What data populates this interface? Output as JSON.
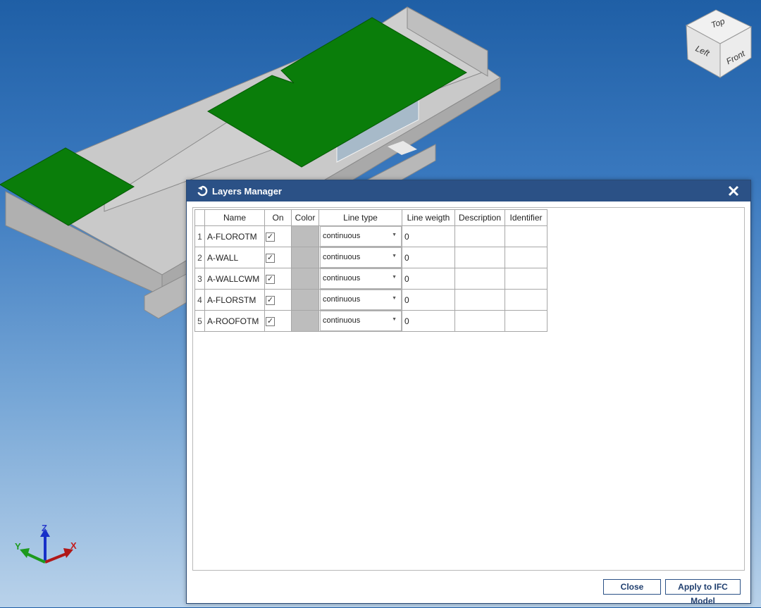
{
  "viewport": {
    "view_cube": {
      "top_label": "Top",
      "left_label": "Left",
      "front_label": "Front"
    },
    "axes": {
      "x_label": "X",
      "y_label": "Y",
      "z_label": "Z"
    }
  },
  "dialog": {
    "title": "Layers Manager",
    "title_icon": "refresh-icon",
    "close_icon": "close-icon",
    "columns": [
      "",
      "Name",
      "On",
      "Color",
      "Line type",
      "Line weigth",
      "Description",
      "Identifier"
    ],
    "rows": [
      {
        "index": "1",
        "name": "A-FLOROTM",
        "on": true,
        "line_type": "continuous",
        "line_weight": "0",
        "description": "",
        "identifier": ""
      },
      {
        "index": "2",
        "name": "A-WALL",
        "on": true,
        "line_type": "continuous",
        "line_weight": "0",
        "description": "",
        "identifier": ""
      },
      {
        "index": "3",
        "name": "A-WALLCWM",
        "on": true,
        "line_type": "continuous",
        "line_weight": "0",
        "description": "",
        "identifier": ""
      },
      {
        "index": "4",
        "name": "A-FLORSTM",
        "on": true,
        "line_type": "continuous",
        "line_weight": "0",
        "description": "",
        "identifier": ""
      },
      {
        "index": "5",
        "name": "A-ROOFOTM",
        "on": true,
        "line_type": "continuous",
        "line_weight": "0",
        "description": "",
        "identifier": ""
      }
    ],
    "buttons": {
      "close": "Close",
      "apply": "Apply to IFC Model"
    }
  },
  "colors": {
    "title_bar": "#2b5186",
    "layer_color": "#bdbdbd",
    "slab_green": "#0a7d0a",
    "wall_gray": "#c4c4c4"
  }
}
